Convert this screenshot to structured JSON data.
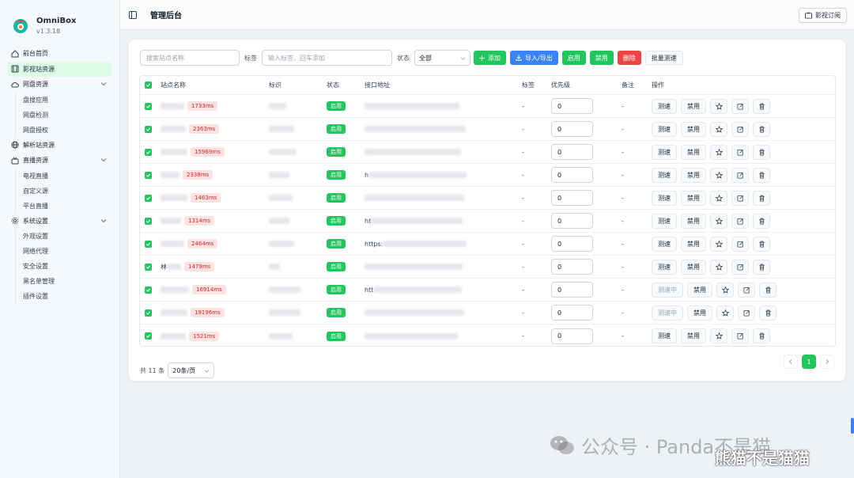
{
  "brand": {
    "name": "OmniBox",
    "version": "v1.3.18"
  },
  "nav": {
    "items": [
      {
        "label": "前台首页",
        "icon": "home-icon"
      },
      {
        "label": "影视站资源",
        "icon": "film-icon",
        "active": true
      },
      {
        "label": "网盘资源",
        "icon": "cloud-icon",
        "expandable": true,
        "children": [
          "盘搜应用",
          "网盘检测",
          "网盘授权"
        ]
      },
      {
        "label": "解析站资源",
        "icon": "globe-icon"
      },
      {
        "label": "直播资源",
        "icon": "tv-icon",
        "expandable": true,
        "children": [
          "电视直播",
          "自定义源",
          "平台直播"
        ]
      },
      {
        "label": "系统设置",
        "icon": "gear-icon",
        "expandable": true,
        "children": [
          "外观设置",
          "网络代理",
          "安全设置",
          "黑名单管理",
          "插件设置"
        ]
      }
    ]
  },
  "header": {
    "title": "管理后台",
    "subscribe_label": "影视订阅"
  },
  "toolbar": {
    "search_placeholder": "搜索站点名称",
    "tag_label": "标签",
    "tag_placeholder": "输入标签，回车添加",
    "status_label": "状态",
    "status_value": "全部",
    "add": "添加",
    "import_export": "导入/导出",
    "enable": "启用",
    "disable": "禁用",
    "delete": "删除",
    "batch_test": "批量测速"
  },
  "table": {
    "headers": [
      "站点名称",
      "标识",
      "状态",
      "接口地址",
      "标签",
      "优先级",
      "备注",
      "操作"
    ],
    "rows": [
      {
        "name_prefix": "",
        "latency": "1733ms",
        "status": "启用",
        "url_prefix": "",
        "tag": "-",
        "priority": "0",
        "note": "-",
        "test": "测速",
        "ban": "禁用"
      },
      {
        "name_prefix": "",
        "latency": "2363ms",
        "status": "启用",
        "url_prefix": "",
        "tag": "-",
        "priority": "0",
        "note": "-",
        "test": "测速",
        "ban": "禁用"
      },
      {
        "name_prefix": "",
        "latency": "15969ms",
        "status": "启用",
        "url_prefix": "",
        "tag": "-",
        "priority": "0",
        "note": "-",
        "test": "测速",
        "ban": "禁用"
      },
      {
        "name_prefix": "",
        "latency": "2338ms",
        "status": "启用",
        "url_prefix": "h",
        "tag": "-",
        "priority": "0",
        "note": "-",
        "test": "测速",
        "ban": "禁用"
      },
      {
        "name_prefix": "",
        "latency": "1463ms",
        "status": "启用",
        "url_prefix": "",
        "tag": "-",
        "priority": "0",
        "note": "-",
        "test": "测速",
        "ban": "禁用"
      },
      {
        "name_prefix": "",
        "latency": "1314ms",
        "status": "启用",
        "url_prefix": "ht",
        "tag": "-",
        "priority": "0",
        "note": "-",
        "test": "测速",
        "ban": "禁用"
      },
      {
        "name_prefix": "",
        "latency": "2464ms",
        "status": "启用",
        "url_prefix": "https:",
        "tag": "-",
        "priority": "0",
        "note": "-",
        "test": "测速",
        "ban": "禁用"
      },
      {
        "name_prefix": "林",
        "latency": "1479ms",
        "status": "启用",
        "url_prefix": "",
        "tag": "-",
        "priority": "0",
        "note": "-",
        "test": "测速",
        "ban": "禁用"
      },
      {
        "name_prefix": "",
        "latency": "16914ms",
        "status": "启用",
        "url_prefix": "htt",
        "tag": "-",
        "priority": "0",
        "note": "-",
        "test": "测速中",
        "ban": "禁用"
      },
      {
        "name_prefix": "",
        "latency": "19196ms",
        "status": "启用",
        "url_prefix": "",
        "tag": "-",
        "priority": "0",
        "note": "-",
        "test": "测速中",
        "ban": "禁用"
      },
      {
        "name_prefix": "",
        "latency": "1521ms",
        "status": "启用",
        "url_prefix": "",
        "tag": "-",
        "priority": "0",
        "note": "-",
        "test": "测速",
        "ban": "禁用"
      }
    ]
  },
  "footer": {
    "total": "共 11 条",
    "page_size": "20条/页",
    "current_page": "1"
  },
  "watermark": {
    "text": "公众号 · Panda不是猫",
    "overlay": "熊猫不是猫猫"
  }
}
